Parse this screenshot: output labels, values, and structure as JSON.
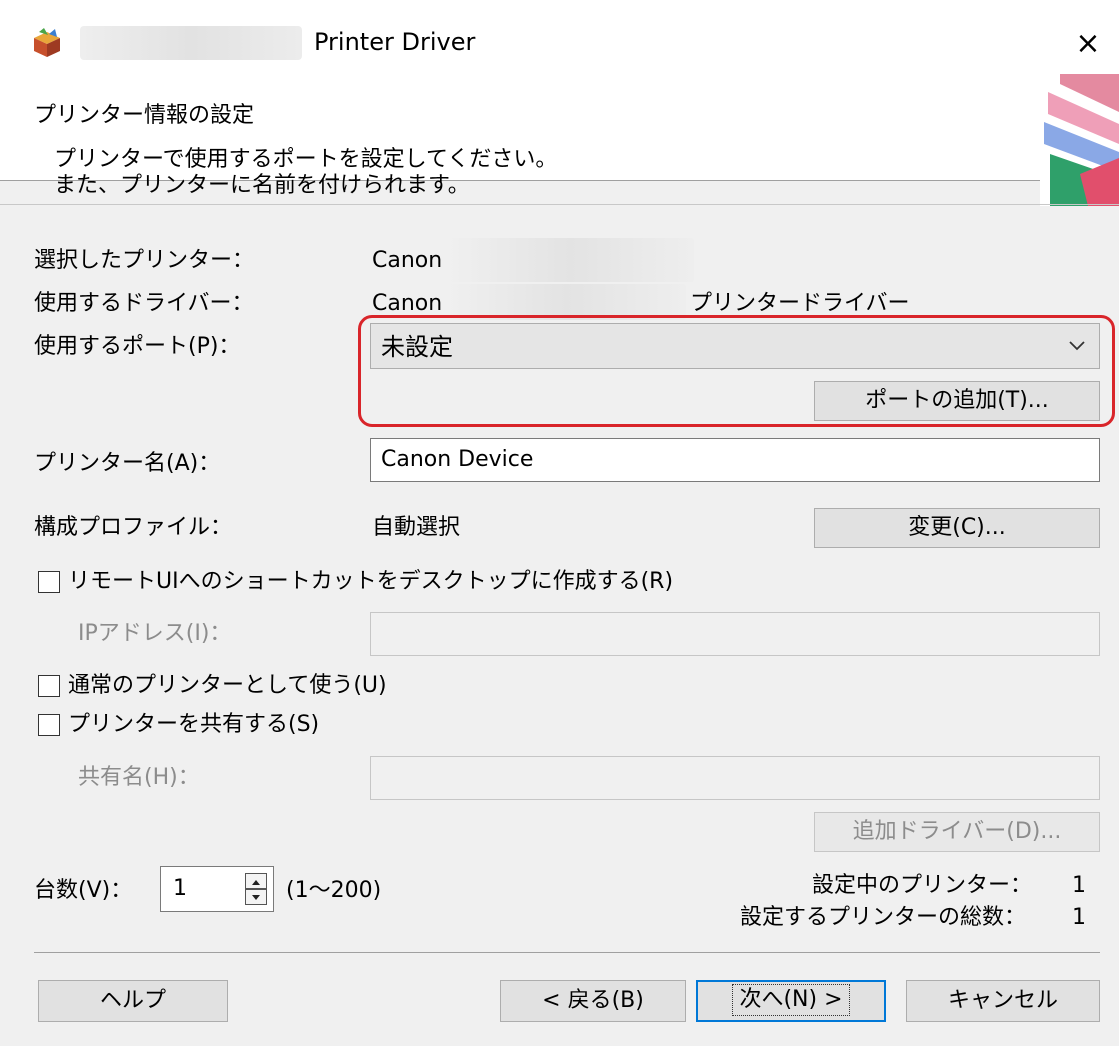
{
  "window": {
    "title": "Printer Driver",
    "close": "×"
  },
  "header": {
    "title": "プリンター情報の設定",
    "desc1": "プリンターで使用するポートを設定してください。",
    "desc2": "また、プリンターに名前を付けられます。"
  },
  "fields": {
    "selected_printer_label": "選択したプリンター：",
    "selected_printer_value": "Canon",
    "driver_label": "使用するドライバー：",
    "driver_value": "Canon",
    "driver_suffix": "プリンタードライバー",
    "port_label": "使用するポート(P)：",
    "port_value": "未設定",
    "add_port_button": "ポートの追加(T)...",
    "printer_name_label": "プリンター名(A)：",
    "printer_name_value": "Canon Device",
    "profile_label": "構成プロファイル：",
    "profile_value": "自動選択",
    "change_button": "変更(C)..."
  },
  "options": {
    "remote_ui_shortcut": "リモートUIへのショートカットをデスクトップに作成する(R)",
    "remote_ui_checked": false,
    "ip_address_label": "IPアドレス(I)：",
    "ip_address_value": "",
    "use_as_normal": "通常のプリンターとして使う(U)",
    "use_as_normal_checked": false,
    "share_printer": "プリンターを共有する(S)",
    "share_printer_checked": false,
    "share_name_label": "共有名(H)：",
    "share_name_value": "",
    "additional_drivers_button": "追加ドライバー(D)..."
  },
  "count": {
    "label": "台数(V)：",
    "value": "1",
    "range": "(1～200)",
    "printers_in_setup_label": "設定中のプリンター：",
    "printers_in_setup_value": "1",
    "total_printers_label": "設定するプリンターの総数：",
    "total_printers_value": "1"
  },
  "footer": {
    "help": "ヘルプ",
    "back": "< 戻る(B)",
    "next": "次へ(N) >",
    "cancel": "キャンセル"
  },
  "colors": {
    "highlight": "#d9252a",
    "dialog_bg": "#f0f0f0",
    "button_bg": "#e1e1e1",
    "default_button_border": "#0078d7"
  },
  "icons": {
    "app": "installer-box-icon",
    "close": "close-icon",
    "dropdown": "chevron-down-icon",
    "spin_up": "spin-up-icon",
    "spin_down": "spin-down-icon"
  }
}
